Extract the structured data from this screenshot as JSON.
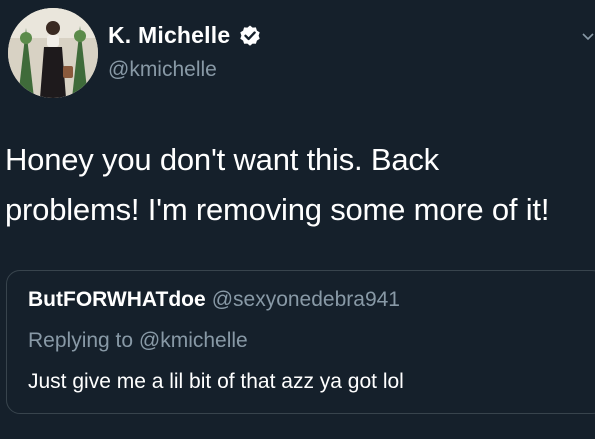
{
  "author": {
    "display_name": "K. Michelle",
    "handle": "@kmichelle",
    "verified": true,
    "avatar_icon": "profile-photo"
  },
  "tweet": {
    "text_lines": [
      "Honey you don't want this. Back",
      "problems! I'm removing some more of it!"
    ]
  },
  "quoted_tweet": {
    "display_name": "ButFORWHATdoe",
    "handle": "@sexyonedebra941",
    "replying_to": "Replying to @kmichelle",
    "text": "Just give me a lil bit of that azz ya got lol"
  },
  "colors": {
    "background": "#15202b",
    "secondary_text": "#8899a6",
    "border": "#38444d",
    "verified_badge": "#ffffff"
  },
  "icons": {
    "verified": "verified-badge-icon",
    "menu": "chevron-down-icon"
  }
}
